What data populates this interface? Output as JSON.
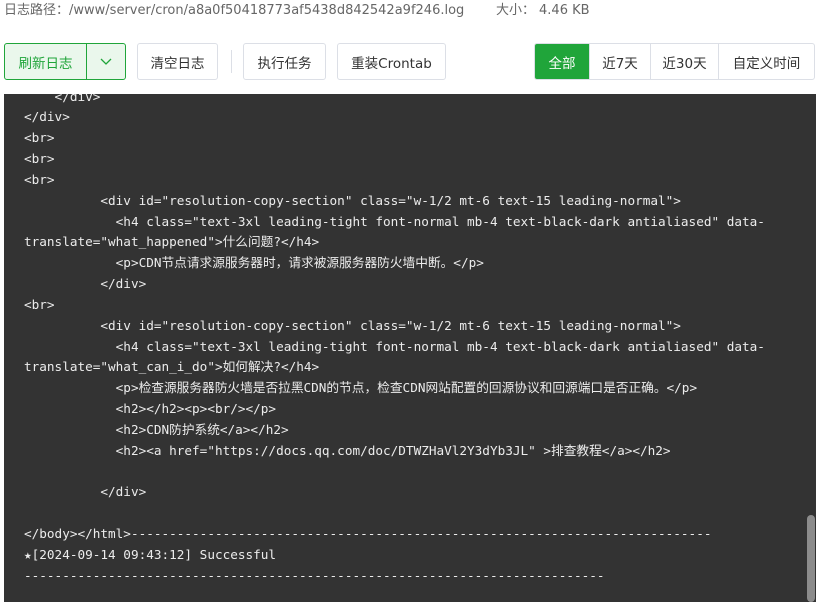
{
  "info": {
    "path_label": "日志路径：",
    "path": "/www/server/cron/a8a0f50418773af5438d842542a9f246.log",
    "size_label": "大小：",
    "size": "4.46 KB"
  },
  "toolbar": {
    "refresh_label": "刷新日志",
    "refresh_menu_icon": "chevron-down-icon",
    "clear_label": "清空日志",
    "run_label": "执行任务",
    "reinstall_label": "重装Crontab"
  },
  "filters": {
    "items": [
      {
        "label": "全部",
        "active": true
      },
      {
        "label": "近7天",
        "active": false
      },
      {
        "label": "近30天",
        "active": false
      },
      {
        "label": "自定义时间",
        "active": false
      }
    ]
  },
  "log": {
    "lines": [
      "    </div>",
      "</div>",
      "<br>",
      "<br>",
      "<br>",
      "          <div id=\"resolution-copy-section\" class=\"w-1/2 mt-6 text-15 leading-normal\">",
      "            <h4 class=\"text-3xl leading-tight font-normal mb-4 text-black-dark antialiased\" data-",
      "translate=\"what_happened\">什么问题?</h4>",
      "            <p>CDN节点请求源服务器时，请求被源服务器防火墙中断。</p>",
      "          </div>",
      "<br>",
      "          <div id=\"resolution-copy-section\" class=\"w-1/2 mt-6 text-15 leading-normal\">",
      "            <h4 class=\"text-3xl leading-tight font-normal mb-4 text-black-dark antialiased\" data-",
      "translate=\"what_can_i_do\">如何解决?</h4>",
      "            <p>检查源服务器防火墙是否拉黑CDN的节点，检查CDN网站配置的回源协议和回源端口是否正确。</p>",
      "            <h2></h2><p><br/></p>",
      "            <h2>CDN防护系统</a></h2>",
      "            <h2><a href=\"https://docs.qq.com/doc/DTWZHaVl2Y3dYb3JL\" >排查教程</a></h2>",
      "",
      "          </div>",
      "",
      "</body></html>----------------------------------------------------------------------------",
      "★[2024-09-14 09:43:12] Successful",
      "----------------------------------------------------------------------------"
    ]
  },
  "colors": {
    "accent": "#20a53a",
    "log_background": "#333333",
    "log_text": "#ececec"
  }
}
